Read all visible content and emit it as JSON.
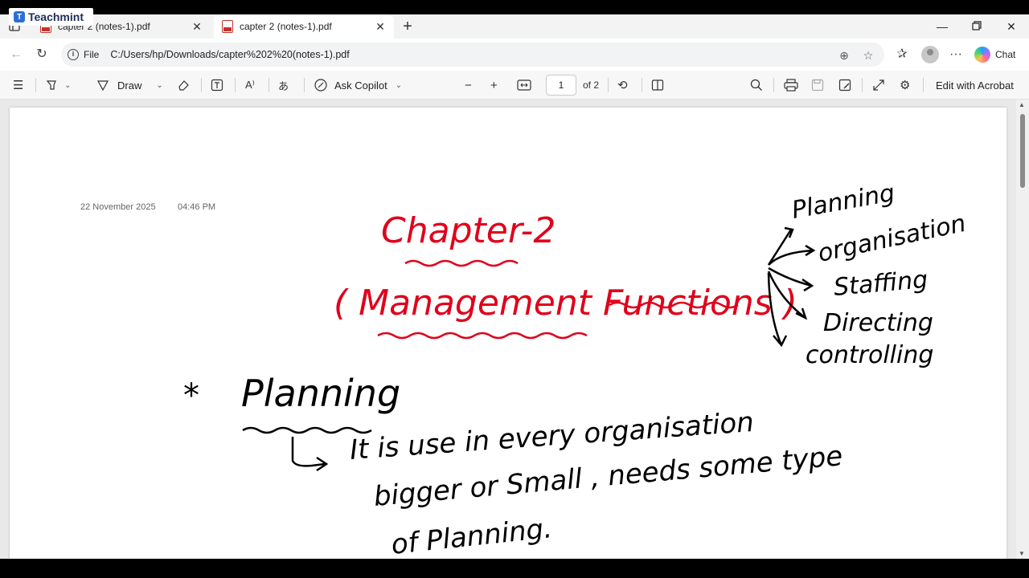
{
  "overlay": {
    "brand": "Teachmint"
  },
  "tabs": [
    {
      "label": "capter 2 (notes-1).pdf",
      "active": false
    },
    {
      "label": "capter 2 (notes-1).pdf",
      "active": true
    }
  ],
  "address": {
    "scheme_label": "File",
    "url": "C:/Users/hp/Downloads/capter%202%20(notes-1).pdf",
    "chat_label": "Chat"
  },
  "toolbar": {
    "draw_label": "Draw",
    "ask_copilot_label": "Ask Copilot",
    "page_current": "1",
    "page_total": "of 2",
    "edit_label": "Edit with Acrobat"
  },
  "document": {
    "date": "22 November 2025",
    "time": "04:46 PM",
    "heading_line1": "Chapter-2",
    "heading_line2": "( Management Functions )",
    "functions": [
      "Planning",
      "organisation",
      "Staffing",
      "Directing",
      "controlling"
    ],
    "section_title": "Planning",
    "body_line1": "It is use in every organisation",
    "body_line2": "bigger or Small , needs some type",
    "body_line3": "of Planning."
  },
  "colors": {
    "ink_black": "#000000",
    "ink_red": "#e0001b",
    "tab_active": "#ffffff",
    "chrome": "#f3f3f3"
  }
}
